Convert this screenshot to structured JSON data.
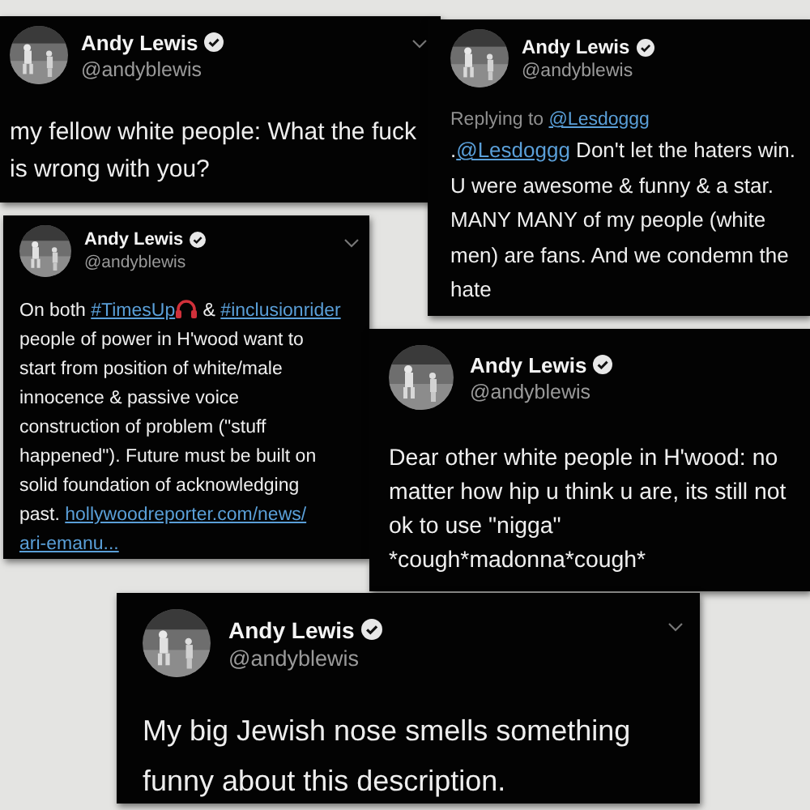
{
  "tweets": [
    {
      "name": "Andy Lewis",
      "handle": "@andyblewis",
      "verified": true,
      "menu": true,
      "body": [
        {
          "kind": "text",
          "text": "my fellow white people: What the fuck is wrong with you?"
        }
      ]
    },
    {
      "name": "Andy Lewis",
      "handle": "@andyblewis",
      "verified": true,
      "menu": false,
      "reply_to": {
        "prefix": "Replying to",
        "user": "@Lesdoggg"
      },
      "body": [
        {
          "kind": "text",
          "text": "."
        },
        {
          "kind": "link",
          "text": "@Lesdoggg"
        },
        {
          "kind": "text",
          "text": " Don't let the haters win. U were awesome & funny & a star. MANY MANY of my people (white men) are fans. And we condemn the hate"
        }
      ]
    },
    {
      "name": "Andy Lewis",
      "handle": "@andyblewis",
      "verified": true,
      "menu": true,
      "body": [
        {
          "kind": "text",
          "text": "On both "
        },
        {
          "kind": "link",
          "text": "#TimesUp"
        },
        {
          "kind": "emoji"
        },
        {
          "kind": "text",
          "text": " & "
        },
        {
          "kind": "link",
          "text": "#inclusionrider"
        },
        {
          "kind": "text",
          "text": " people of power in H'wood want to start from position of white/male innocence & passive voice construction of problem (\"stuff happened\"). Future must be built on solid foundation of acknowledging past. "
        },
        {
          "kind": "link",
          "text": "hollywoodreporter.com/news/"
        },
        {
          "kind": "link",
          "text": "ari-emanu..."
        }
      ]
    },
    {
      "name": "Andy Lewis",
      "handle": "@andyblewis",
      "verified": true,
      "menu": false,
      "body": [
        {
          "kind": "text",
          "text": "Dear other white people in H'wood: no matter how hip u think u are, its still not ok to use \"nigga\" *cough*madonna*cough*"
        }
      ]
    },
    {
      "name": "Andy Lewis",
      "handle": "@andyblewis",
      "verified": true,
      "menu": true,
      "body": [
        {
          "kind": "text",
          "text": "My big Jewish nose smells something funny about this description."
        }
      ]
    }
  ]
}
